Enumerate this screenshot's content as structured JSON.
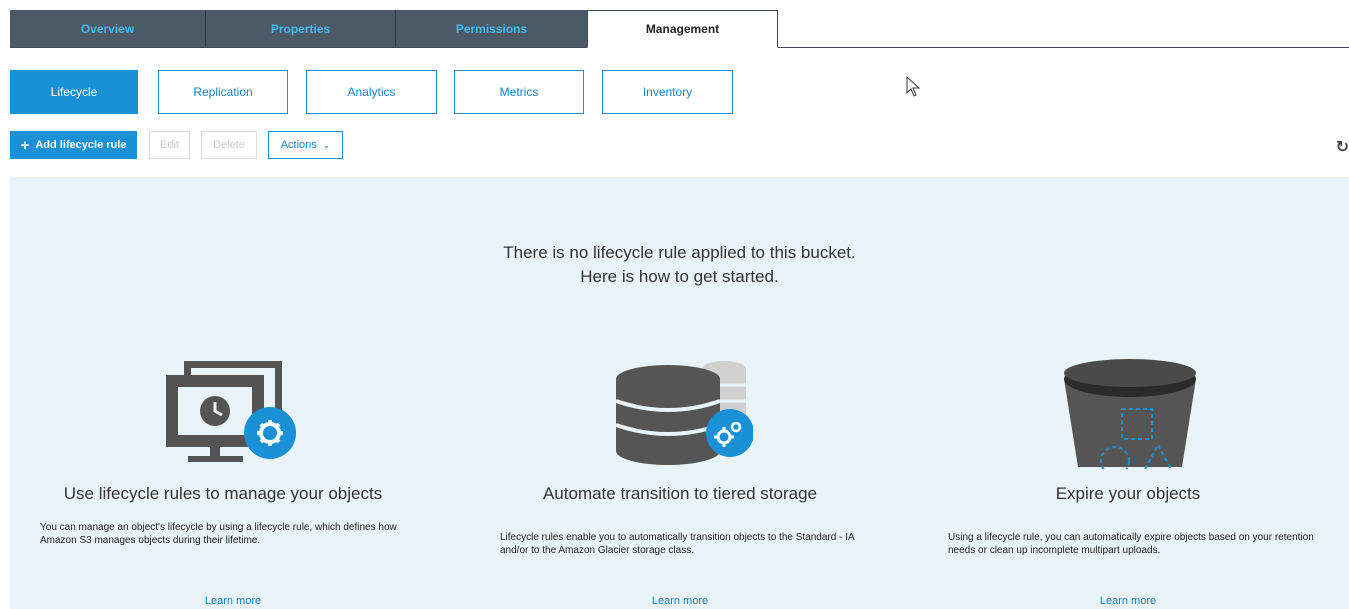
{
  "tabs": [
    {
      "label": "Overview",
      "active": false
    },
    {
      "label": "Properties",
      "active": false
    },
    {
      "label": "Permissions",
      "active": false
    },
    {
      "label": "Management",
      "active": true
    }
  ],
  "subtabs": [
    {
      "label": "Lifecycle",
      "active": true
    },
    {
      "label": "Replication",
      "active": false
    },
    {
      "label": "Analytics",
      "active": false
    },
    {
      "label": "Metrics",
      "active": false
    },
    {
      "label": "Inventory",
      "active": false
    }
  ],
  "toolbar": {
    "add_label": "Add lifecycle rule",
    "edit_label": "Edit",
    "delete_label": "Delete",
    "actions_label": "Actions"
  },
  "empty": {
    "line1": "There is no lifecycle rule applied to this bucket.",
    "line2": "Here is how to get started."
  },
  "cards": [
    {
      "title": "Use lifecycle rules to manage your objects",
      "desc": "You can manage an object's lifecycle by using a lifecycle rule, which defines how Amazon S3 manages objects during their lifetime.",
      "link": "Learn more"
    },
    {
      "title": "Automate transition to tiered storage",
      "desc": "Lifecycle rules enable you to automatically transition objects to the Standard - IA and/or to the Amazon Glacier storage class.",
      "link": "Learn more"
    },
    {
      "title": "Expire your objects",
      "desc": "Using a lifecycle rule, you can automatically expire objects based on your retention needs or clean up incomplete multipart uploads.",
      "link": "Learn more"
    }
  ],
  "colors": {
    "accent": "#1a90d6",
    "tab_dark": "#4c5a68",
    "panel_bg": "#e8f3fa"
  }
}
